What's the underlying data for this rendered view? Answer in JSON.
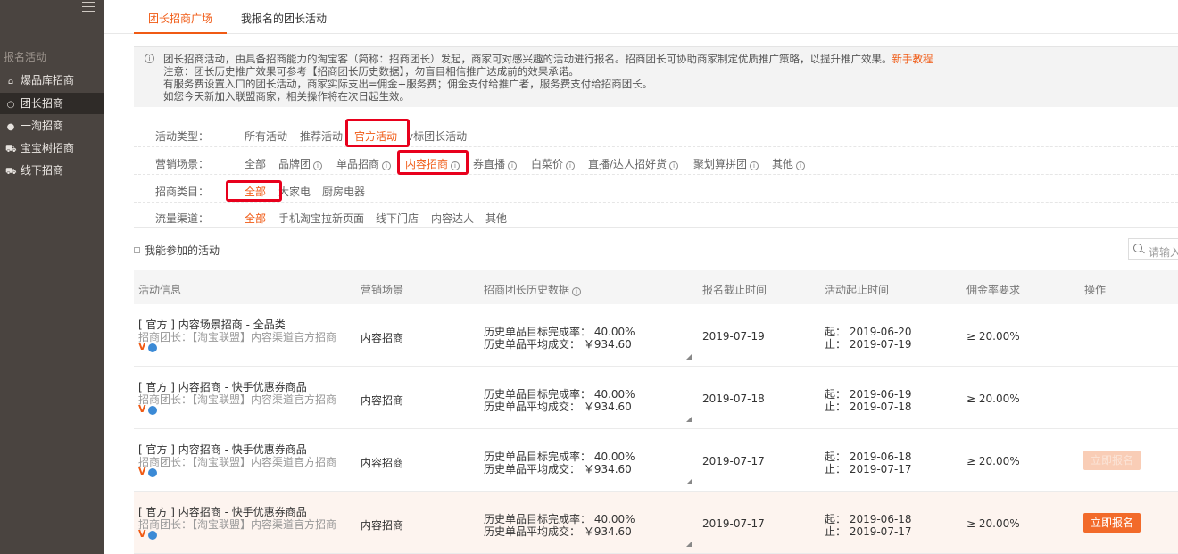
{
  "sidebar": {
    "section_title": "报名活动",
    "items": [
      {
        "label": "爆品库招商",
        "icon": "home-icon"
      },
      {
        "label": "团长招商",
        "icon": "group-icon"
      },
      {
        "label": "一淘招商",
        "icon": "yitao-icon"
      },
      {
        "label": "宝宝树招商",
        "icon": "cart-icon"
      },
      {
        "label": "线下招商",
        "icon": "cart-icon"
      }
    ]
  },
  "tabs": [
    "团长招商广场",
    "我报名的团长活动"
  ],
  "notice": {
    "line1": "团长招商活动，由具备招商能力的淘宝客（简称：招商团长）发起，商家可对感兴趣的活动进行报名。招商团长可协助商家制定优质推广策略，以提升推广效果。",
    "link": "新手教程",
    "line2": "注意：团长历史推广效果可参考【招商团长历史数据】，勿盲目相信推广达成前的效果承诺。",
    "line3": "有服务费设置入口的团长活动，商家实际支出=佣金+服务费；佣金支付给推广者，服务费支付给招商团长。",
    "line4": "如您今天新加入联盟商家，相关操作将在次日起生效。"
  },
  "filters": {
    "type": {
      "label": "活动类型：",
      "options": [
        "所有活动",
        "推荐活动",
        "官方活动",
        "v标团长活动"
      ]
    },
    "scene": {
      "label": "营销场景：",
      "options": [
        "全部",
        "品牌团",
        "单品招商",
        "内容招商",
        "券直播",
        "白菜价",
        "直播/达人招好货",
        "聚划算拼团",
        "其他"
      ]
    },
    "category": {
      "label": "招商类目：",
      "options": [
        "全部",
        "大家电",
        "厨房电器"
      ]
    },
    "channel": {
      "label": "流量渠道：",
      "options": [
        "全部",
        "手机淘宝拉新页面",
        "线下门店",
        "内容达人",
        "其他"
      ]
    }
  },
  "my_activities_label": "我能参加的活动",
  "search": {
    "placeholder": "请输入"
  },
  "table": {
    "headers": [
      "活动信息",
      "营销场景",
      "招商团长历史数据",
      "报名截止时间",
      "活动起止时间",
      "佣金率要求",
      "操作"
    ],
    "rows": [
      {
        "title": "[ 官方 ] 内容场景招商 - 全品类",
        "leader": "招商团长：【淘宝联盟】内容渠道官方招商",
        "scene": "内容招商",
        "rate_line": "历史单品目标完成率： 40.00%",
        "deal_line": "历史单品平均成交： ￥934.60",
        "deadline": "2019-07-19",
        "start": "起： 2019-06-20",
        "end": "止： 2019-07-19",
        "commission": "≥ 20.00%",
        "action": ""
      },
      {
        "title": "[ 官方 ] 内容招商 - 快手优惠券商品",
        "leader": "招商团长：【淘宝联盟】内容渠道官方招商",
        "scene": "内容招商",
        "rate_line": "历史单品目标完成率： 40.00%",
        "deal_line": "历史单品平均成交： ￥934.60",
        "deadline": "2019-07-18",
        "start": "起： 2019-06-19",
        "end": "止： 2019-07-18",
        "commission": "≥ 20.00%",
        "action": ""
      },
      {
        "title": "[ 官方 ] 内容招商 - 快手优惠券商品",
        "leader": "招商团长：【淘宝联盟】内容渠道官方招商",
        "scene": "内容招商",
        "rate_line": "历史单品目标完成率： 40.00%",
        "deal_line": "历史单品平均成交： ￥934.60",
        "deadline": "2019-07-17",
        "start": "起： 2019-06-18",
        "end": "止： 2019-07-17",
        "commission": "≥ 20.00%",
        "action": "立即报名"
      },
      {
        "title": "[ 官方 ] 内容招商 - 快手优惠券商品",
        "leader": "招商团长：【淘宝联盟】内容渠道官方招商",
        "scene": "内容招商",
        "rate_line": "历史单品目标完成率： 40.00%",
        "deal_line": "历史单品平均成交： ￥934.60",
        "deadline": "2019-07-17",
        "start": "起： 2019-06-18",
        "end": "止： 2019-07-17",
        "commission": "≥ 20.00%",
        "action": "立即报名"
      }
    ]
  },
  "colors": {
    "accent": "#f05a14",
    "sidebar_bg": "#4a4440",
    "highlight_box": "#e8001c"
  }
}
